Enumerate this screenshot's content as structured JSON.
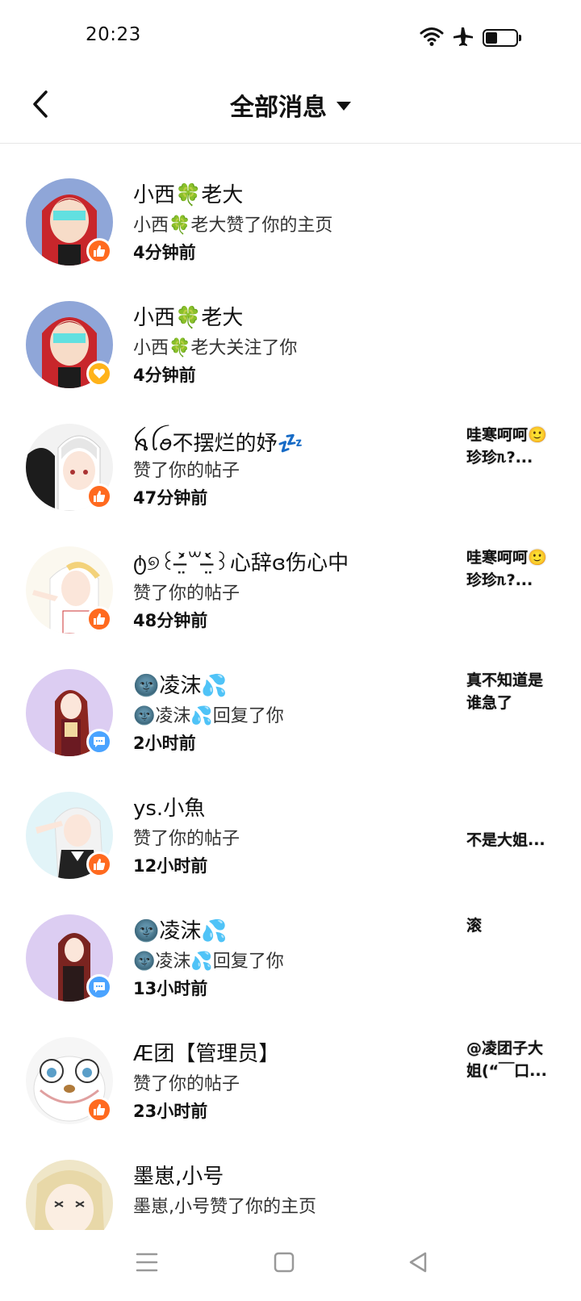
{
  "status_bar": {
    "time": "20:23",
    "icons": [
      "wifi-icon",
      "airplane-icon",
      "battery-icon"
    ],
    "battery_level": 0.35
  },
  "header": {
    "title": "全部消息",
    "back_icon": "chevron-left-icon",
    "dropdown_icon": "caret-down-icon"
  },
  "messages": [
    {
      "name": "小西🍀老大",
      "action": "小西🍀老大赞了你的主页",
      "time": "4分钟前",
      "badge": "like",
      "preview": "",
      "avatar_color": "#c8262b"
    },
    {
      "name": "小西🍀老大",
      "action": "小西🍀老大关注了你",
      "time": "4分钟前",
      "badge": "follow",
      "preview": "",
      "avatar_color": "#c8262b"
    },
    {
      "name": "ꫝꪶꪮ不摆烂的妤💤",
      "action": "赞了你的帖子",
      "time": "47分钟前",
      "badge": "like",
      "preview": "哇寒呵呵🙂珍珍ᥰ?...",
      "avatar_color": "#e8e8e8"
    },
    {
      "name": "ტ୭꒰˃̶̤́꒳˂̶̤̀꒱心辞ɞ伤心中",
      "action": "赞了你的帖子",
      "time": "48分钟前",
      "badge": "like",
      "preview": "哇寒呵呵🙂珍珍ᥰ?...",
      "avatar_color": "#f0ecdf"
    },
    {
      "name": "🌚凌沫💦",
      "action": "🌚凌沫💦回复了你",
      "time": "2小时前",
      "badge": "reply",
      "preview": "真不知道是谁急了",
      "avatar_color": "#d9c9f0"
    },
    {
      "name": "ys.小魚",
      "action": "赞了你的帖子",
      "time": "12小时前",
      "badge": "like",
      "preview": "不是大姐...",
      "avatar_color": "#dff2f6"
    },
    {
      "name": "🌚凌沫💦",
      "action": "🌚凌沫💦回复了你",
      "time": "13小时前",
      "badge": "reply",
      "preview": "滚",
      "avatar_color": "#d9c9f0"
    },
    {
      "name": "Æ团【管理员】",
      "action": "赞了你的帖子",
      "time": "23小时前",
      "badge": "like",
      "preview": "@凌团子大姐(“￣口...",
      "avatar_color": "#f4f4f4"
    },
    {
      "name": "墨崽,小号",
      "action": "墨崽,小号赞了你的主页",
      "time": "",
      "badge": "none",
      "preview": "",
      "avatar_color": "#efe6c8"
    }
  ],
  "nav_bar": {
    "icons": [
      "menu-icon",
      "home-square-icon",
      "back-triangle-icon"
    ]
  }
}
